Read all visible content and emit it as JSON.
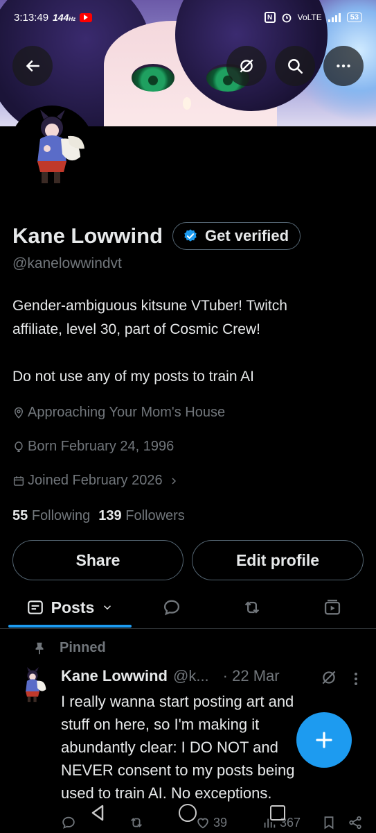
{
  "status_bar": {
    "time": "3:13:49",
    "refresh": "144",
    "refresh_unit": "Hz",
    "network": "VoLTE",
    "battery": "53"
  },
  "header": {
    "back_icon": "arrow-left-icon",
    "grok_icon": "grok-slash-icon",
    "search_icon": "search-icon",
    "more_icon": "more-horizontal-icon"
  },
  "profile": {
    "name": "Kane Lowwind",
    "get_verified_label": "Get verified",
    "handle": "@kanelowwindvt",
    "bio_lines": [
      "Gender-ambiguous kitsune VTuber! Twitch",
      "affiliate, level 30, part of Cosmic Crew!",
      "",
      "Do not use any of my posts to train AI"
    ],
    "location": "Approaching Your Mom's House",
    "birthday": "Born February 24, 1996",
    "joined": "Joined February 2026",
    "following_count": "55",
    "following_label": "Following",
    "followers_count": "139",
    "followers_label": "Followers",
    "share_label": "Share",
    "edit_label": "Edit profile"
  },
  "tabs": {
    "posts_label": "Posts"
  },
  "post": {
    "pinned_label": "Pinned",
    "author": "Kane Lowwind",
    "handle": "@k...",
    "date": "· 22 Mar",
    "text_lines": [
      "I really wanna start posting art and",
      "stuff on here, so I'm making it",
      "abundantly clear: I DO NOT and",
      "NEVER consent to my posts being",
      "used to train AI. No exceptions."
    ],
    "likes": "39",
    "views": "367"
  },
  "colors": {
    "accent": "#1d9bf0",
    "muted": "#71767b",
    "text": "#e7e9ea",
    "border": "#536471"
  }
}
